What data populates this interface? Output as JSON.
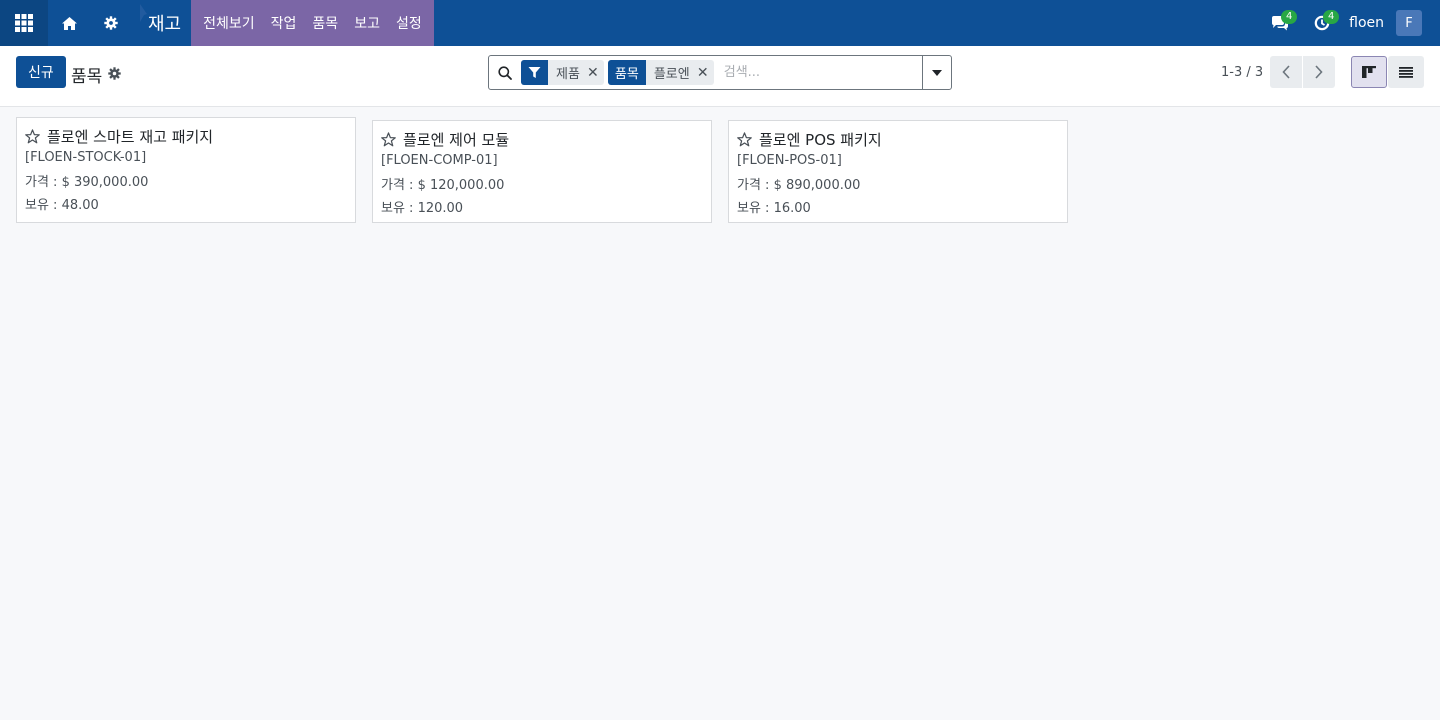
{
  "navbar": {
    "app_name": "재고",
    "menu": [
      "전체보기",
      "작업",
      "품목",
      "보고",
      "설정"
    ],
    "messages_badge": "4",
    "activities_badge": "4",
    "user_name": "floen",
    "avatar_letter": "F",
    "colors": {
      "navbar": "#0e5096",
      "menu_highlight": "#7b66a6",
      "badge": "#28a745"
    }
  },
  "control": {
    "new_button": "신규",
    "breadcrumb": "품목",
    "facets": [
      {
        "category_icon": "filter-icon",
        "value": "제품"
      },
      {
        "category": "품목",
        "value": "플로엔"
      }
    ],
    "search_placeholder": "검색...",
    "pager": "1-3 / 3",
    "active_view": "kanban"
  },
  "products": [
    {
      "name": "플로엔 스마트 재고 패키지",
      "ref": "[FLOEN-STOCK-01]",
      "price": "가격 : $ 390,000.00",
      "on_hand": "보유 : 48.00"
    },
    {
      "name": "플로엔 제어 모듈",
      "ref": "[FLOEN-COMP-01]",
      "price": "가격 : $ 120,000.00",
      "on_hand": "보유 : 120.00"
    },
    {
      "name": "플로엔 POS 패키지",
      "ref": "[FLOEN-POS-01]",
      "price": "가격 : $ 890,000.00",
      "on_hand": "보유 : 16.00"
    }
  ]
}
